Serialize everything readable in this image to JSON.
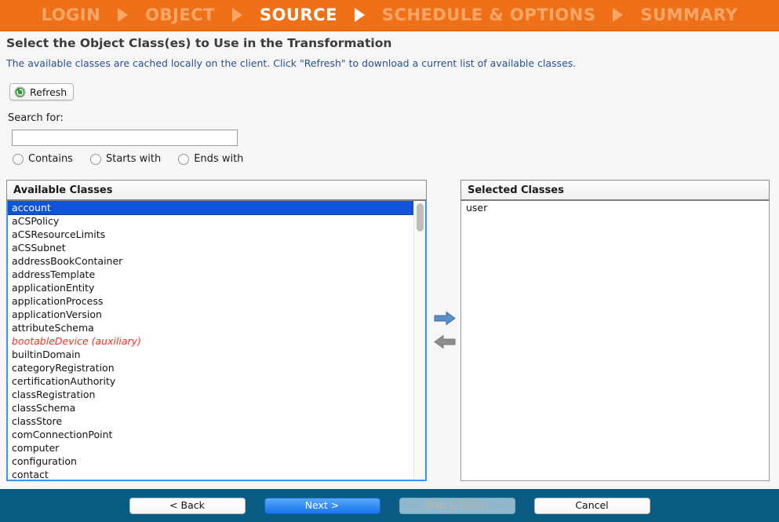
{
  "wizard": {
    "steps": [
      {
        "label": "LOGIN",
        "active": false
      },
      {
        "label": "OBJECT",
        "active": false
      },
      {
        "label": "SOURCE",
        "active": true
      },
      {
        "label": "SCHEDULE & OPTIONS",
        "active": false
      },
      {
        "label": "SUMMARY",
        "active": false
      }
    ],
    "accent_color": "#f07018",
    "active_step_color": "#ffffff",
    "inactive_step_color": "#f8a769"
  },
  "page": {
    "title": "Select the Object Class(es) to Use in the Transformation",
    "subtitle": "The available classes are cached locally on the client. Click \"Refresh\" to download a current list of available classes.",
    "subtitle_color": "#27518f"
  },
  "toolbar": {
    "refresh_label": "Refresh",
    "refresh_icon": "refresh-circle-icon"
  },
  "search": {
    "label": "Search for:",
    "value": "",
    "placeholder": "",
    "options": [
      {
        "label": "Contains",
        "checked": false
      },
      {
        "label": "Starts with",
        "checked": false
      },
      {
        "label": "Ends with",
        "checked": false
      }
    ]
  },
  "available": {
    "header": "Available Classes",
    "selected_index": 0,
    "items": [
      {
        "label": "account",
        "auxiliary": false
      },
      {
        "label": "aCSPolicy",
        "auxiliary": false
      },
      {
        "label": "aCSResourceLimits",
        "auxiliary": false
      },
      {
        "label": "aCSSubnet",
        "auxiliary": false
      },
      {
        "label": "addressBookContainer",
        "auxiliary": false
      },
      {
        "label": "addressTemplate",
        "auxiliary": false
      },
      {
        "label": "applicationEntity",
        "auxiliary": false
      },
      {
        "label": "applicationProcess",
        "auxiliary": false
      },
      {
        "label": "applicationVersion",
        "auxiliary": false
      },
      {
        "label": "attributeSchema",
        "auxiliary": false
      },
      {
        "label": "bootableDevice (auxiliary)",
        "auxiliary": true
      },
      {
        "label": "builtinDomain",
        "auxiliary": false
      },
      {
        "label": "categoryRegistration",
        "auxiliary": false
      },
      {
        "label": "certificationAuthority",
        "auxiliary": false
      },
      {
        "label": "classRegistration",
        "auxiliary": false
      },
      {
        "label": "classSchema",
        "auxiliary": false
      },
      {
        "label": "classStore",
        "auxiliary": false
      },
      {
        "label": "comConnectionPoint",
        "auxiliary": false
      },
      {
        "label": "computer",
        "auxiliary": false
      },
      {
        "label": "configuration",
        "auxiliary": false
      },
      {
        "label": "contact",
        "auxiliary": false
      }
    ],
    "selection_color": "#1053d4",
    "auxiliary_color": "#ff2d20"
  },
  "selected": {
    "header": "Selected Classes",
    "items": [
      {
        "label": "user"
      }
    ]
  },
  "transfer": {
    "add_icon": "arrow-right-icon",
    "add_enabled": true,
    "remove_icon": "arrow-left-icon",
    "remove_enabled": false,
    "add_color": "#5b8fc9",
    "remove_color": "#8d8d8d"
  },
  "footer": {
    "background": "#0b5c85",
    "buttons": [
      {
        "label": "< Back",
        "style": "plain",
        "enabled": true
      },
      {
        "label": "Next >",
        "style": "primary",
        "enabled": true
      },
      {
        "label": "Map & Finish",
        "style": "disabled",
        "enabled": false
      },
      {
        "label": "Cancel",
        "style": "plain",
        "enabled": true
      }
    ]
  }
}
